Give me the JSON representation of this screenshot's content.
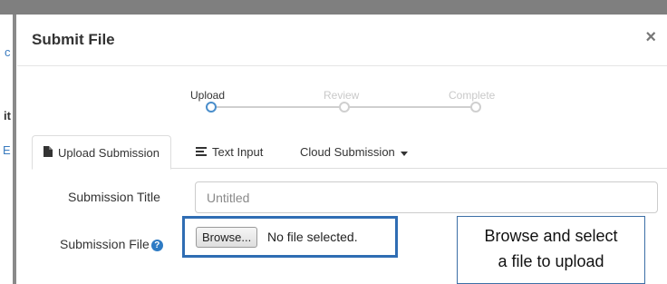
{
  "background": {
    "glyphs": [
      "c",
      "it",
      "E"
    ]
  },
  "modal": {
    "title": "Submit File",
    "close_label": "×"
  },
  "stepper": {
    "steps": [
      {
        "label": "Upload",
        "active": true
      },
      {
        "label": "Review",
        "active": false
      },
      {
        "label": "Complete",
        "active": false
      }
    ]
  },
  "tabs": [
    {
      "label": "Upload Submission",
      "icon": "file-icon",
      "active": true
    },
    {
      "label": "Text Input",
      "icon": "text-lines-icon",
      "active": false
    },
    {
      "label": "Cloud Submission",
      "icon": "caret-down-icon",
      "active": false
    }
  ],
  "form": {
    "title_label": "Submission Title",
    "title_placeholder": "Untitled",
    "file_label": "Submission File",
    "help_icon_glyph": "?",
    "browse_label": "Browse...",
    "file_status": "No file selected."
  },
  "callout": {
    "line1": "Browse and select",
    "line2": "a file to upload"
  },
  "colors": {
    "accent": "#2f6db3",
    "help_icon": "#2e7bc4",
    "arrow": "#3f74b8"
  }
}
